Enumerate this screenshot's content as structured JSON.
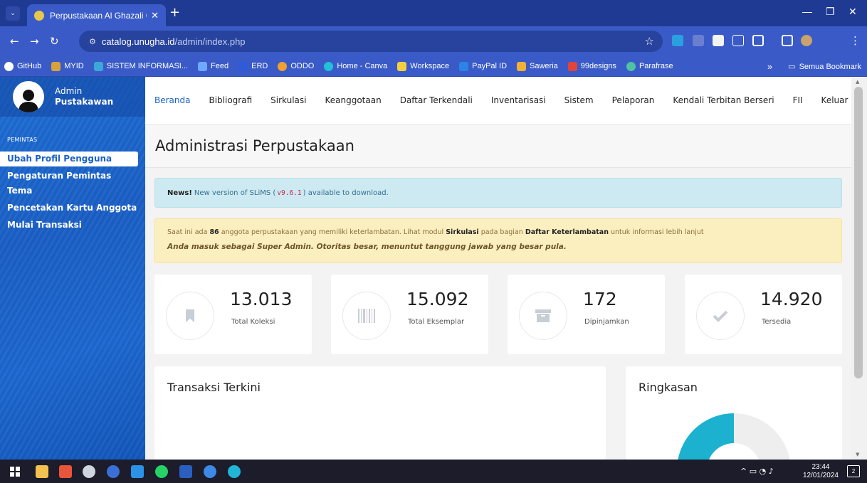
{
  "browser": {
    "tab_title": "Perpustakaan Al Ghazali Cilacap",
    "tab_close": "✕",
    "new_tab": "+",
    "url_host": "catalog.unugha.id",
    "url_path": "/admin/index.php"
  },
  "bookmarks": {
    "items": [
      {
        "label": "GitHub",
        "color": "#ffffff"
      },
      {
        "label": "MYID",
        "color": "#d8a33a"
      },
      {
        "label": "SISTEM INFORMASI...",
        "color": "#3ca8d8"
      },
      {
        "label": "Feed",
        "color": "#6fa8ff"
      },
      {
        "label": "ERD",
        "color": "#2f5bd9"
      },
      {
        "label": "ODDO",
        "color": "#f0a030"
      },
      {
        "label": "Home - Canva",
        "color": "#22c1d6"
      },
      {
        "label": "Workspace",
        "color": "#f4d03f"
      },
      {
        "label": "PayPal ID",
        "color": "#2b84e6"
      },
      {
        "label": "Saweria",
        "color": "#f2b134"
      },
      {
        "label": "99designs",
        "color": "#e0443a"
      },
      {
        "label": "Parafrase",
        "color": "#4fc3a1"
      }
    ],
    "more": "»",
    "all_bookmarks": "Semua Bookmark"
  },
  "sidebar": {
    "user_line1": "Admin",
    "user_line2": "Pustakawan",
    "section_title": "PEMINTAS",
    "items": [
      {
        "label": "Ubah Profil Pengguna",
        "active": true
      },
      {
        "label": "Pengaturan Pemintas",
        "active": false
      },
      {
        "label": "Tema",
        "active": false
      },
      {
        "label": "Pencetakan Kartu Anggota",
        "active": false
      },
      {
        "label": "Mulai Transaksi",
        "active": false
      }
    ]
  },
  "nav": {
    "items": [
      "Beranda",
      "Bibliografi",
      "Sirkulasi",
      "Keanggotaan",
      "Daftar Terkendali",
      "Inventarisasi",
      "Sistem",
      "Pelaporan",
      "Kendali Terbitan Berseri",
      "FII",
      "Keluar"
    ]
  },
  "page": {
    "title": "Administrasi Perpustakaan",
    "news_label": "News!",
    "news_text_before": "New version of SLiMS (",
    "news_version": "v9.6.1",
    "news_text_after": ") available to download.",
    "warn_p1": "Saat ini ada ",
    "warn_count": "86",
    "warn_p2": " anggota perpustakaan yang memiliki keterlambatan. Lihat modul ",
    "warn_module": "Sirkulasi",
    "warn_p3": " pada bagian ",
    "warn_section": "Daftar Keterlambatan",
    "warn_p4": " untuk informasi lebih lanjut",
    "warn_line2": "Anda masuk sebagai Super Admin. Otoritas besar, menuntut tanggung jawab yang besar pula."
  },
  "stats": [
    {
      "value": "13.013",
      "label": "Total Koleksi",
      "icon": "bookmark-icon"
    },
    {
      "value": "15.092",
      "label": "Total Eksemplar",
      "icon": "barcode-icon"
    },
    {
      "value": "172",
      "label": "Dipinjamkan",
      "icon": "archive-icon"
    },
    {
      "value": "14.920",
      "label": "Tersedia",
      "icon": "check-icon"
    }
  ],
  "panels": {
    "recent_transactions": "Transaksi Terkini",
    "summary": "Ringkasan"
  },
  "summary_chart": {
    "colors": {
      "primary": "#1bb1cf",
      "rest": "#eeeeee"
    }
  },
  "taskbar": {
    "time": "23:44",
    "date": "12/01/2024",
    "notif_count": "2"
  }
}
